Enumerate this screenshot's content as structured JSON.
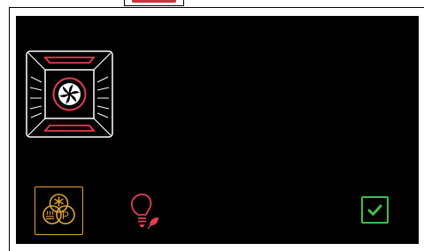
{
  "colors": {
    "screen_bg": "#000000",
    "heater": "#e23d55",
    "fan": "#e23d55",
    "oven_outline": "#ffffff",
    "mode_accent": "#e0a23a",
    "bulb": "#e23d55",
    "confirm": "#3fbf4d"
  },
  "icons": {
    "oven": "oven-fan-heating-icon",
    "mode": "mode-snowflake-pyrolysis-icon",
    "light": "lamp-eco-icon",
    "confirm": "checkmark-icon"
  }
}
